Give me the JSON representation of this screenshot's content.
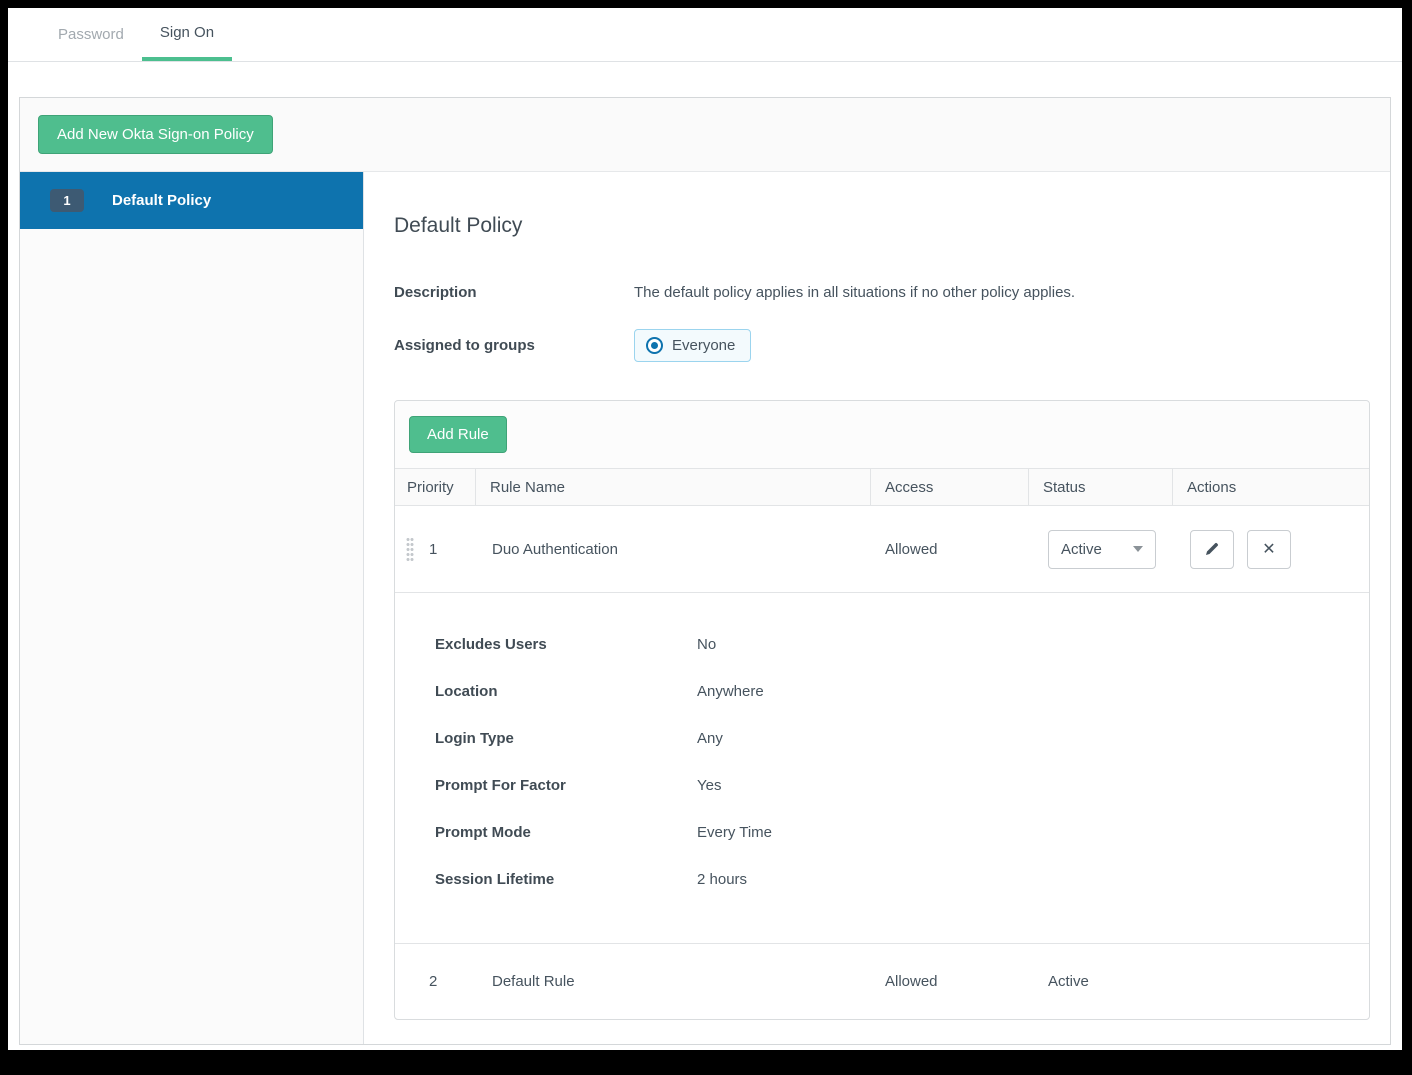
{
  "tabs": {
    "password": "Password",
    "sign_on": "Sign On"
  },
  "toolbar": {
    "add_policy_label": "Add New Okta Sign-on Policy"
  },
  "sidebar": {
    "policies": [
      {
        "priority": "1",
        "name": "Default Policy"
      }
    ]
  },
  "policy": {
    "title": "Default Policy",
    "description_label": "Description",
    "description": "The default policy applies in all situations if no other policy applies.",
    "assigned_label": "Assigned to groups",
    "assigned_value": "Everyone"
  },
  "rules": {
    "add_rule_label": "Add Rule",
    "columns": [
      "Priority",
      "Rule Name",
      "Access",
      "Status",
      "Actions"
    ],
    "rows": [
      {
        "priority": "1",
        "name": "Duo Authentication",
        "access": "Allowed",
        "status": "Active"
      },
      {
        "priority": "2",
        "name": "Default Rule",
        "access": "Allowed",
        "status": "Active"
      }
    ],
    "details": [
      {
        "label": "Excludes Users",
        "value": "No"
      },
      {
        "label": "Location",
        "value": "Anywhere"
      },
      {
        "label": "Login Type",
        "value": "Any"
      },
      {
        "label": "Prompt For Factor",
        "value": "Yes"
      },
      {
        "label": "Prompt Mode",
        "value": "Every Time"
      },
      {
        "label": "Session Lifetime",
        "value": "2 hours"
      }
    ],
    "delete_icon_glyph": "✕"
  },
  "colors": {
    "accent_green": "#4fbe8e",
    "selected_blue": "#0e73ae",
    "badge_navy": "#3d5a73",
    "text_dark": "#46535e"
  }
}
